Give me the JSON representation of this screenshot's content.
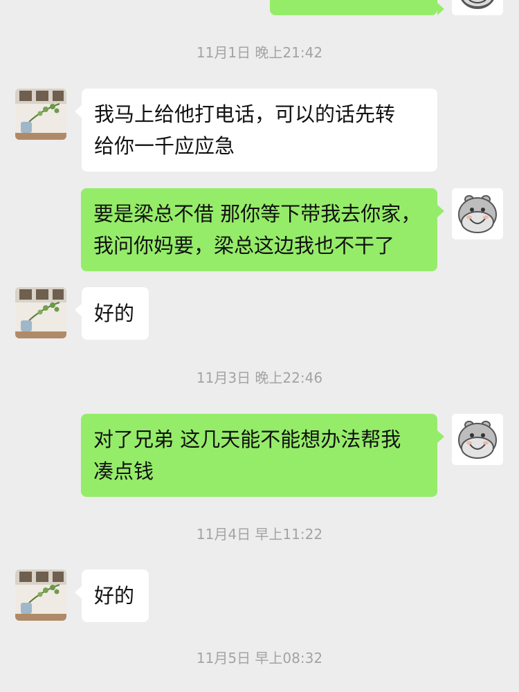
{
  "chat": {
    "timestamps": [
      "11月1日 晚上21:42",
      "11月3日 晚上22:46",
      "11月4日 早上11:22",
      "11月5日 早上08:32"
    ],
    "messages": [
      {
        "side": "in",
        "text": "我马上给他打电话，可以的话先转\n给你一千应应急"
      },
      {
        "side": "out",
        "text": "要是梁总不借 那你等下带我去你家，\n我问你妈要，梁总这边我也不干了"
      },
      {
        "side": "in",
        "text": "好的"
      },
      {
        "side": "out",
        "text": "对了兄弟 这几天能不能想办法帮我\n凑点钱"
      },
      {
        "side": "in",
        "text": "好的"
      }
    ]
  },
  "icons": {
    "contact_avatar": "plant-photo-avatar",
    "self_avatar": "hippo-avatar"
  },
  "colors": {
    "background": "#ededed",
    "outgoing_bubble": "#95ec69",
    "incoming_bubble": "#ffffff",
    "timestamp_text": "#a3a3a3"
  }
}
